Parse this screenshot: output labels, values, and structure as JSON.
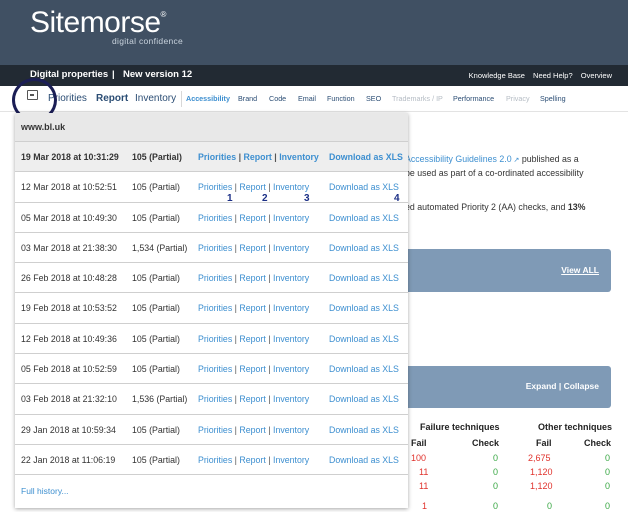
{
  "header": {
    "logo": "Sitemorse",
    "logo_mark": "®",
    "tagline": "digital confidence"
  },
  "topbar": {
    "title": "Digital properties",
    "separator": "|",
    "subtitle": "New version 12",
    "links": [
      "Knowledge Base",
      "Need Help?",
      "Overview"
    ]
  },
  "nav": {
    "calendar_icon": "calendar-icon",
    "primary": [
      "Priorities",
      "Report",
      "Inventory"
    ],
    "tabs": [
      "Accessibility",
      "Brand",
      "Code",
      "Email",
      "Function",
      "SEO",
      "Trademarks / IP",
      "Performance",
      "Privacy",
      "Spelling"
    ]
  },
  "background": {
    "line1_link": "Accessibility Guidelines 2.0",
    "line1_rest": " published as a",
    "line2": "be used as part of a co-ordinated accessibility",
    "line3": "ed automated Priority 2 (AA) checks, and ",
    "line3_bold": "13%",
    "view_all": "View ALL",
    "expand": "Expand",
    "collapse_sep": " | ",
    "collapse": "Collapse",
    "failure_heading": "Failure techniques",
    "other_heading": "Other techniques",
    "col_fail": "Fail",
    "col_check": "Check",
    "rows": [
      {
        "f1": "100",
        "c1": "0",
        "f2": "2,675",
        "c2": "0"
      },
      {
        "f1": "11",
        "c1": "0",
        "f2": "1,120",
        "c2": "0"
      },
      {
        "f1": "11",
        "c1": "0",
        "f2": "1,120",
        "c2": "0"
      },
      {
        "f1": "1",
        "c1": "0",
        "f2": "0",
        "c2": "0"
      }
    ]
  },
  "dropdown": {
    "site": "www.bl.uk",
    "rows": [
      {
        "date": "19 Mar 2018 at 10:31:29",
        "count": "105 (Partial)"
      },
      {
        "date": "12 Mar 2018 at 10:52:51",
        "count": "105 (Partial)"
      },
      {
        "date": "05 Mar 2018 at 10:49:30",
        "count": "105 (Partial)"
      },
      {
        "date": "03 Mar 2018 at 21:38:30",
        "count": "1,534 (Partial)"
      },
      {
        "date": "26 Feb 2018 at 10:48:28",
        "count": "105 (Partial)"
      },
      {
        "date": "19 Feb 2018 at 10:53:52",
        "count": "105 (Partial)"
      },
      {
        "date": "12 Feb 2018 at 10:49:36",
        "count": "105 (Partial)"
      },
      {
        "date": "05 Feb 2018 at 10:52:59",
        "count": "105 (Partial)"
      },
      {
        "date": "03 Feb 2018 at 21:32:10",
        "count": "1,536 (Partial)"
      },
      {
        "date": "29 Jan 2018 at 10:59:34",
        "count": "105 (Partial)"
      },
      {
        "date": "22 Jan 2018 at 11:06:19",
        "count": "105 (Partial)"
      }
    ],
    "link_priorities": "Priorities",
    "link_report": "Report",
    "link_inventory": "Inventory",
    "link_sep": " | ",
    "download": "Download as XLS",
    "markers": [
      "1",
      "2",
      "3",
      "4"
    ],
    "footer": "Full history..."
  },
  "colors": {
    "header_bg": "#405063",
    "topbar_bg": "#222a33",
    "link": "#3d8fd0",
    "fail_red": "#e0322c",
    "pass_green": "#3aa845",
    "panel_blue": "#7f9ab6",
    "annotation": "#1b1e55"
  }
}
